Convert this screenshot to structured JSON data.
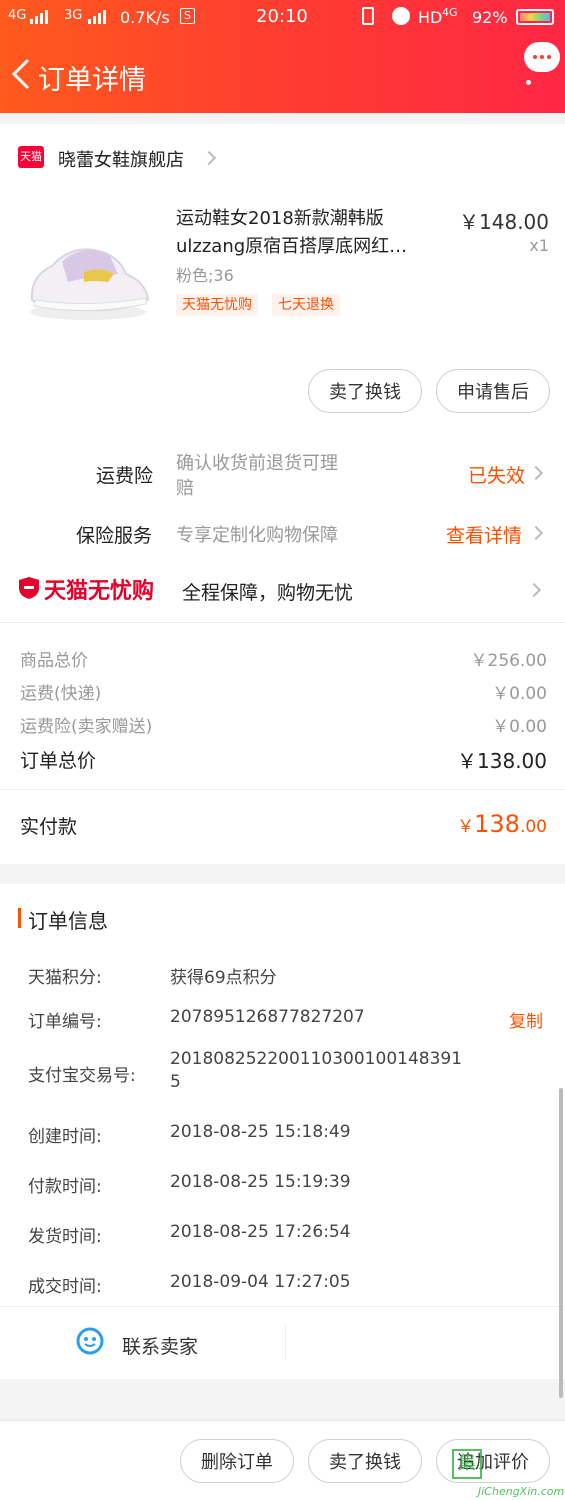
{
  "status_bar": {
    "signal_1": "4G",
    "signal_2": "3G",
    "speed": "0.7K/s",
    "time": "20:10",
    "network": "HD",
    "network_2": "4G",
    "battery": "92%"
  },
  "nav": {
    "title": "订单详情"
  },
  "shop": {
    "badge": "天猫",
    "name": "晓蕾女鞋旗舰店"
  },
  "product": {
    "title_line1": "运动鞋女2018新款潮韩版",
    "title_line2": "ulzzang原宿百搭厚底网红…",
    "sku": "粉色;36",
    "price": "￥148.00",
    "qty": "x1",
    "tags": [
      "天猫无忧购",
      "七天退换"
    ]
  },
  "item_actions": {
    "sell": "卖了换钱",
    "after_sale": "申请售后"
  },
  "services": {
    "freight_label": "运费险",
    "freight_desc_1": "确认收货前退货可理",
    "freight_desc_2": "赔",
    "freight_status": "已失效",
    "insurance_label": "保险服务",
    "insurance_desc": "专享定制化购物保障",
    "insurance_link": "查看详情",
    "tmall_brand": "天猫无忧购",
    "tmall_desc": "全程保障，购物无忧"
  },
  "price_summary": {
    "goods_label": "商品总价",
    "goods_value": "￥256.00",
    "shipping_label": "运费(快递)",
    "shipping_value": "￥0.00",
    "freight_ins_label": "运费险(卖家赠送)",
    "freight_ins_value": "￥0.00",
    "order_total_label": "订单总价",
    "order_total_value": "￥138.00",
    "paid_label": "实付款",
    "paid_currency": "￥",
    "paid_int": "138",
    "paid_dec": ".00"
  },
  "order_info": {
    "title": "订单信息",
    "rows": [
      {
        "label": "天猫积分:",
        "value": "获得69点积分"
      },
      {
        "label": "订单编号:",
        "value": "207895126877827207"
      },
      {
        "label": "支付宝交易号:",
        "value": "20180825220011030010014839​1"
      },
      {
        "label": "创建时间:",
        "value": "2018-08-25 15:18:49"
      },
      {
        "label": "付款时间:",
        "value": "2018-08-25 15:19:39"
      },
      {
        "label": "发货时间:",
        "value": "2018-08-25 17:26:54"
      },
      {
        "label": "成交时间:",
        "value": "2018-09-04 17:27:05"
      }
    ],
    "alipay_line1": "201808252200110300100148391",
    "alipay_line2": "5",
    "copy": "复制"
  },
  "contact": {
    "label": "联系卖家"
  },
  "bottom_bar": {
    "delete": "删除订单",
    "sell": "卖了换钱",
    "review": "追加评价"
  },
  "watermark": {
    "text": "JiChengXin.com"
  },
  "colors": {
    "accent": "#ff5000",
    "header_start": "#ff5a1e",
    "header_end": "#ff2745",
    "tmall_red": "#e4002b"
  }
}
